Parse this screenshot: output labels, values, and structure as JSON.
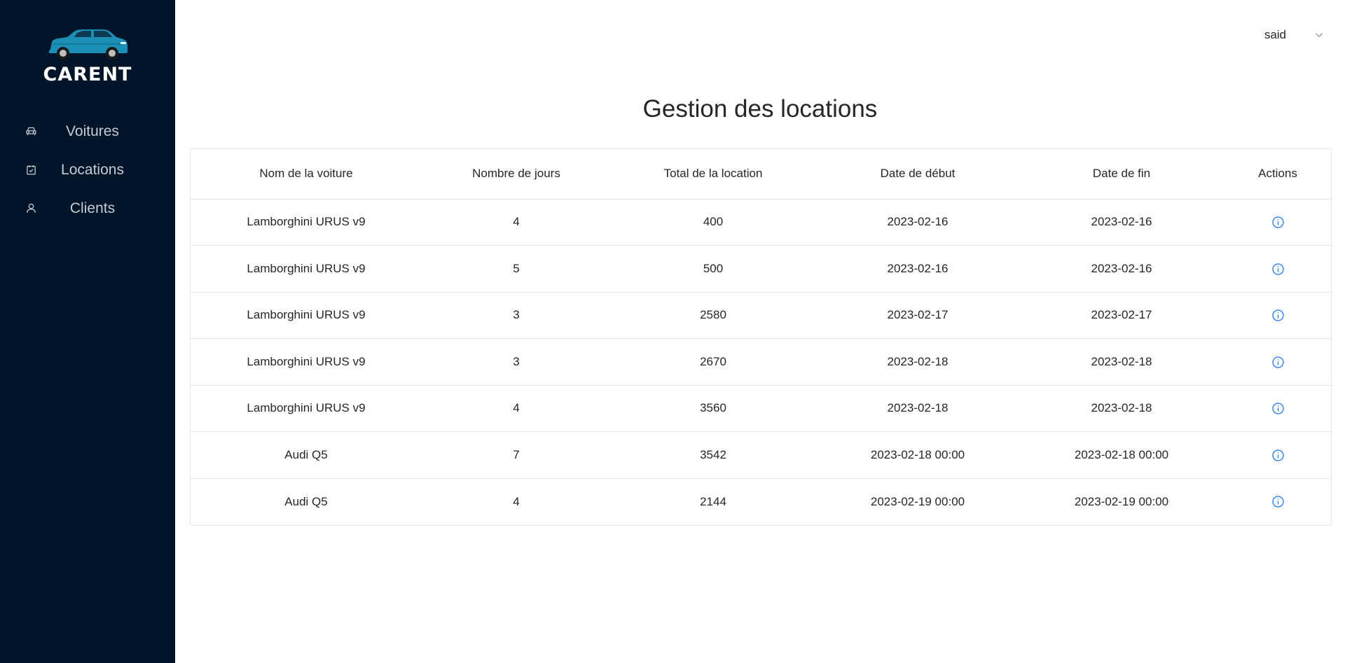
{
  "brand": {
    "name": "CARENT",
    "car_color": "#1b8fb5"
  },
  "sidebar": {
    "items": [
      {
        "label": "Voitures",
        "icon": "car-icon"
      },
      {
        "label": "Locations",
        "icon": "calendar-check-icon"
      },
      {
        "label": "Clients",
        "icon": "user-icon"
      }
    ]
  },
  "header": {
    "user": "said"
  },
  "page": {
    "title": "Gestion des locations"
  },
  "table": {
    "columns": [
      "Nom de la voiture",
      "Nombre de jours",
      "Total de la location",
      "Date de début",
      "Date de fin",
      "Actions"
    ],
    "rows": [
      [
        "Lamborghini URUS v9",
        "4",
        "400",
        "2023-02-16",
        "2023-02-16"
      ],
      [
        "Lamborghini URUS v9",
        "5",
        "500",
        "2023-02-16",
        "2023-02-16"
      ],
      [
        "Lamborghini URUS v9",
        "3",
        "2580",
        "2023-02-17",
        "2023-02-17"
      ],
      [
        "Lamborghini URUS v9",
        "3",
        "2670",
        "2023-02-18",
        "2023-02-18"
      ],
      [
        "Lamborghini URUS v9",
        "4",
        "3560",
        "2023-02-18",
        "2023-02-18"
      ],
      [
        "Audi Q5",
        "7",
        "3542",
        "2023-02-18 00:00",
        "2023-02-18 00:00"
      ],
      [
        "Audi Q5",
        "4",
        "2144",
        "2023-02-19 00:00",
        "2023-02-19 00:00"
      ]
    ],
    "action_icon": "info-circle-icon",
    "accent": "#1677ff"
  }
}
